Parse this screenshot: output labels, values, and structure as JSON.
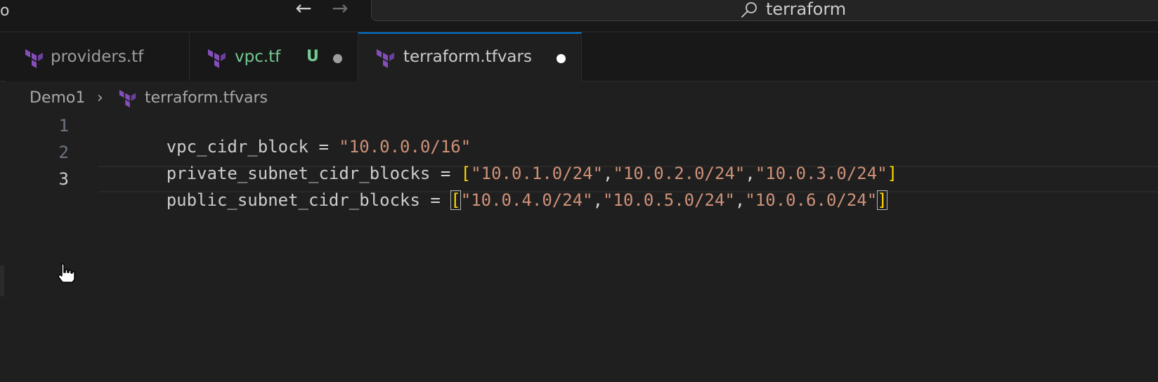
{
  "window": {
    "title_fragment": "o",
    "nav": {
      "back_icon": "arrow-left-icon",
      "forward_icon": "arrow-right-icon"
    },
    "search": {
      "icon": "search-icon",
      "text": "terraform"
    }
  },
  "tabs": [
    {
      "label": "providers.tf",
      "icon": "terraform-icon",
      "status": "",
      "dirty": false,
      "active": false
    },
    {
      "label": "vpc.tf",
      "icon": "terraform-icon",
      "status": "U",
      "dirty": true,
      "active": false
    },
    {
      "label": "terraform.tfvars",
      "icon": "terraform-icon",
      "status": "",
      "dirty": true,
      "active": true
    }
  ],
  "breadcrumb": {
    "folder": "Demo1",
    "file": "terraform.tfvars"
  },
  "editor": {
    "lines": [
      {
        "number": "1",
        "key": "vpc_cidr_block",
        "op": " = ",
        "value": "\"10.0.0.0/16\""
      },
      {
        "number": "2",
        "key": "private_subnet_cidr_blocks",
        "op": " = ",
        "open": "[",
        "items": [
          "\"10.0.1.0/24\"",
          "\"10.0.2.0/24\"",
          "\"10.0.3.0/24\""
        ],
        "close": "]"
      },
      {
        "number": "3",
        "key": "public_subnet_cidr_blocks",
        "op": " = ",
        "open": "[",
        "items": [
          "\"10.0.4.0/24\"",
          "\"10.0.5.0/24\"",
          "\"10.0.6.0/24\""
        ],
        "close": "]"
      }
    ],
    "current_line": "3"
  },
  "colors": {
    "background": "#1f1f1f",
    "string": "#ce9178",
    "bracket": "#ffd700",
    "terraform_purple": "#844fba",
    "untracked_green": "#73c991",
    "active_tab_border": "#0078d4"
  }
}
